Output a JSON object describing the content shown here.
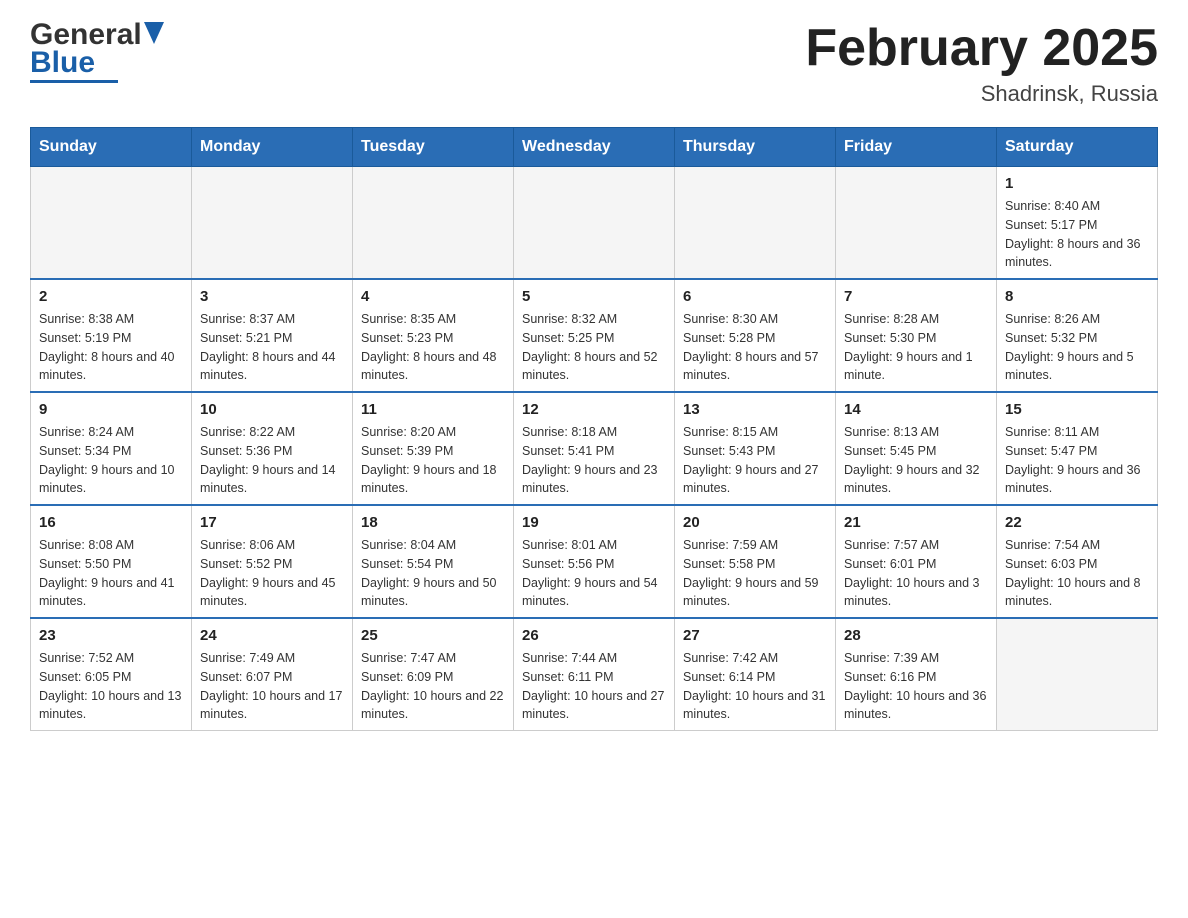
{
  "header": {
    "logo_general": "General",
    "logo_blue": "Blue",
    "title": "February 2025",
    "subtitle": "Shadrinsk, Russia"
  },
  "calendar": {
    "days_of_week": [
      "Sunday",
      "Monday",
      "Tuesday",
      "Wednesday",
      "Thursday",
      "Friday",
      "Saturday"
    ],
    "weeks": [
      {
        "days": [
          {
            "date": "",
            "info": ""
          },
          {
            "date": "",
            "info": ""
          },
          {
            "date": "",
            "info": ""
          },
          {
            "date": "",
            "info": ""
          },
          {
            "date": "",
            "info": ""
          },
          {
            "date": "",
            "info": ""
          },
          {
            "date": "1",
            "info": "Sunrise: 8:40 AM\nSunset: 5:17 PM\nDaylight: 8 hours and 36 minutes."
          }
        ]
      },
      {
        "days": [
          {
            "date": "2",
            "info": "Sunrise: 8:38 AM\nSunset: 5:19 PM\nDaylight: 8 hours and 40 minutes."
          },
          {
            "date": "3",
            "info": "Sunrise: 8:37 AM\nSunset: 5:21 PM\nDaylight: 8 hours and 44 minutes."
          },
          {
            "date": "4",
            "info": "Sunrise: 8:35 AM\nSunset: 5:23 PM\nDaylight: 8 hours and 48 minutes."
          },
          {
            "date": "5",
            "info": "Sunrise: 8:32 AM\nSunset: 5:25 PM\nDaylight: 8 hours and 52 minutes."
          },
          {
            "date": "6",
            "info": "Sunrise: 8:30 AM\nSunset: 5:28 PM\nDaylight: 8 hours and 57 minutes."
          },
          {
            "date": "7",
            "info": "Sunrise: 8:28 AM\nSunset: 5:30 PM\nDaylight: 9 hours and 1 minute."
          },
          {
            "date": "8",
            "info": "Sunrise: 8:26 AM\nSunset: 5:32 PM\nDaylight: 9 hours and 5 minutes."
          }
        ]
      },
      {
        "days": [
          {
            "date": "9",
            "info": "Sunrise: 8:24 AM\nSunset: 5:34 PM\nDaylight: 9 hours and 10 minutes."
          },
          {
            "date": "10",
            "info": "Sunrise: 8:22 AM\nSunset: 5:36 PM\nDaylight: 9 hours and 14 minutes."
          },
          {
            "date": "11",
            "info": "Sunrise: 8:20 AM\nSunset: 5:39 PM\nDaylight: 9 hours and 18 minutes."
          },
          {
            "date": "12",
            "info": "Sunrise: 8:18 AM\nSunset: 5:41 PM\nDaylight: 9 hours and 23 minutes."
          },
          {
            "date": "13",
            "info": "Sunrise: 8:15 AM\nSunset: 5:43 PM\nDaylight: 9 hours and 27 minutes."
          },
          {
            "date": "14",
            "info": "Sunrise: 8:13 AM\nSunset: 5:45 PM\nDaylight: 9 hours and 32 minutes."
          },
          {
            "date": "15",
            "info": "Sunrise: 8:11 AM\nSunset: 5:47 PM\nDaylight: 9 hours and 36 minutes."
          }
        ]
      },
      {
        "days": [
          {
            "date": "16",
            "info": "Sunrise: 8:08 AM\nSunset: 5:50 PM\nDaylight: 9 hours and 41 minutes."
          },
          {
            "date": "17",
            "info": "Sunrise: 8:06 AM\nSunset: 5:52 PM\nDaylight: 9 hours and 45 minutes."
          },
          {
            "date": "18",
            "info": "Sunrise: 8:04 AM\nSunset: 5:54 PM\nDaylight: 9 hours and 50 minutes."
          },
          {
            "date": "19",
            "info": "Sunrise: 8:01 AM\nSunset: 5:56 PM\nDaylight: 9 hours and 54 minutes."
          },
          {
            "date": "20",
            "info": "Sunrise: 7:59 AM\nSunset: 5:58 PM\nDaylight: 9 hours and 59 minutes."
          },
          {
            "date": "21",
            "info": "Sunrise: 7:57 AM\nSunset: 6:01 PM\nDaylight: 10 hours and 3 minutes."
          },
          {
            "date": "22",
            "info": "Sunrise: 7:54 AM\nSunset: 6:03 PM\nDaylight: 10 hours and 8 minutes."
          }
        ]
      },
      {
        "days": [
          {
            "date": "23",
            "info": "Sunrise: 7:52 AM\nSunset: 6:05 PM\nDaylight: 10 hours and 13 minutes."
          },
          {
            "date": "24",
            "info": "Sunrise: 7:49 AM\nSunset: 6:07 PM\nDaylight: 10 hours and 17 minutes."
          },
          {
            "date": "25",
            "info": "Sunrise: 7:47 AM\nSunset: 6:09 PM\nDaylight: 10 hours and 22 minutes."
          },
          {
            "date": "26",
            "info": "Sunrise: 7:44 AM\nSunset: 6:11 PM\nDaylight: 10 hours and 27 minutes."
          },
          {
            "date": "27",
            "info": "Sunrise: 7:42 AM\nSunset: 6:14 PM\nDaylight: 10 hours and 31 minutes."
          },
          {
            "date": "28",
            "info": "Sunrise: 7:39 AM\nSunset: 6:16 PM\nDaylight: 10 hours and 36 minutes."
          },
          {
            "date": "",
            "info": ""
          }
        ]
      }
    ]
  }
}
